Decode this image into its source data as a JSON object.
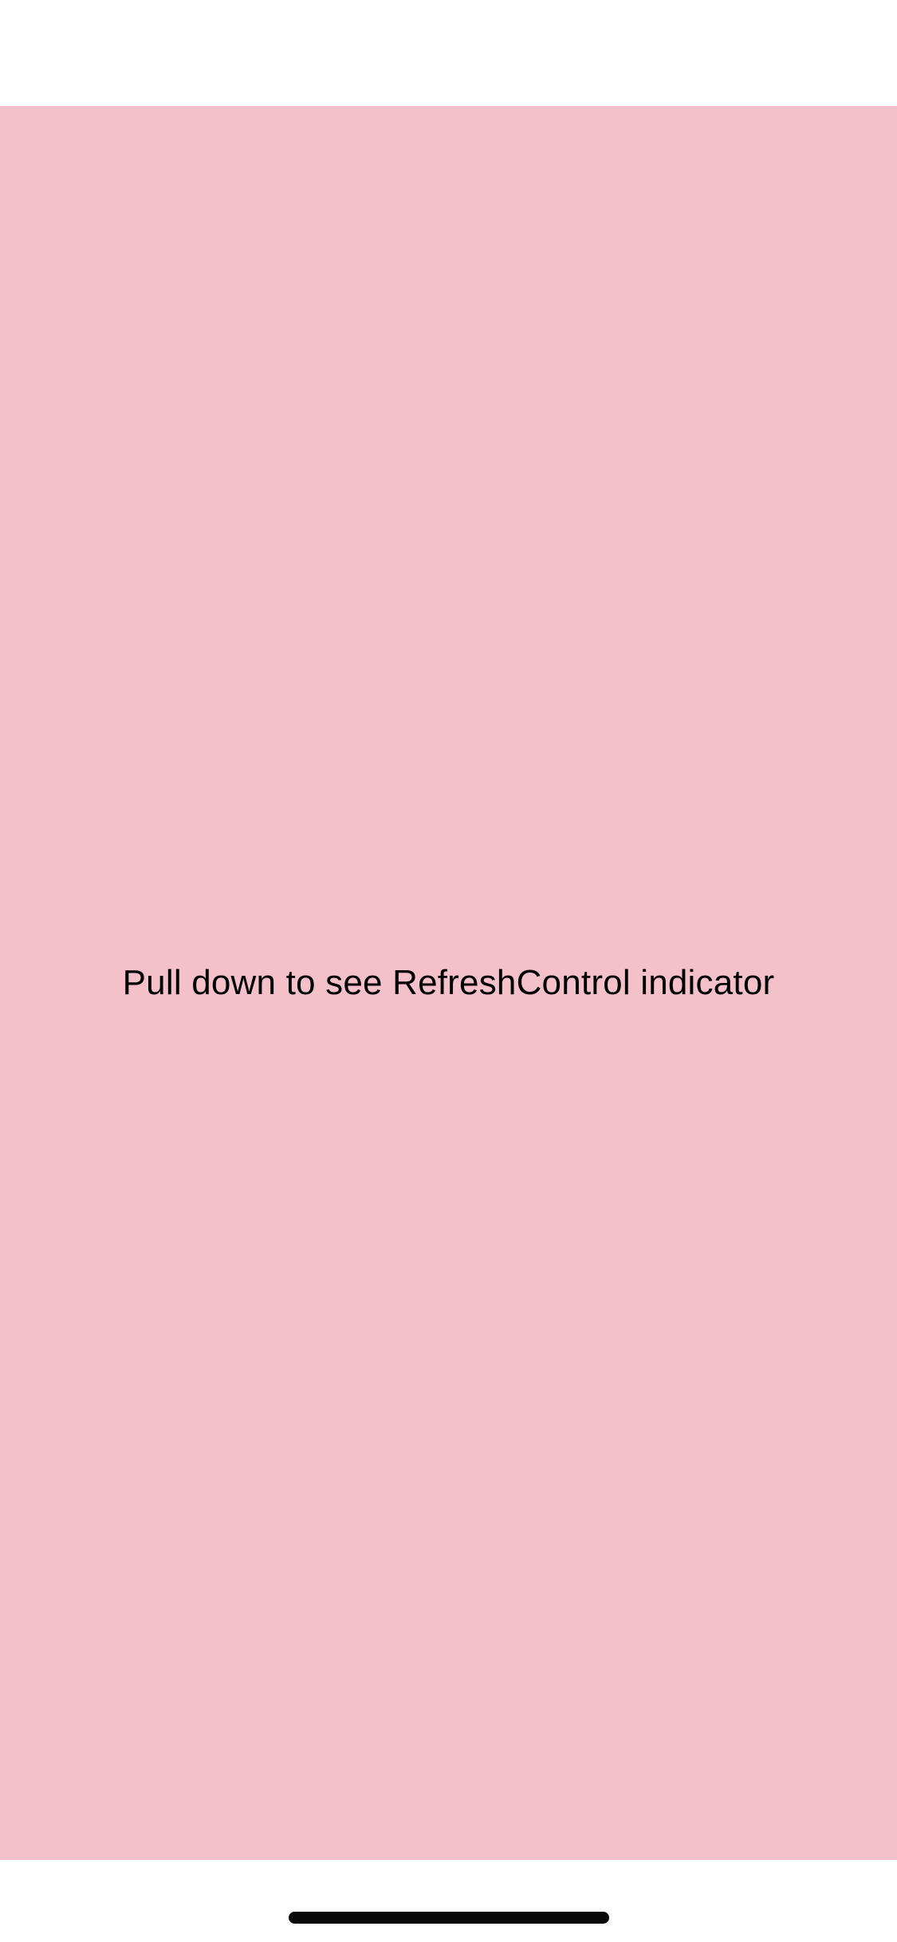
{
  "scroll_view": {
    "background_color": "#f4c1ca",
    "message": "Pull down to see RefreshControl indicator"
  },
  "home_indicator": {
    "color": "#0a0a0a"
  }
}
